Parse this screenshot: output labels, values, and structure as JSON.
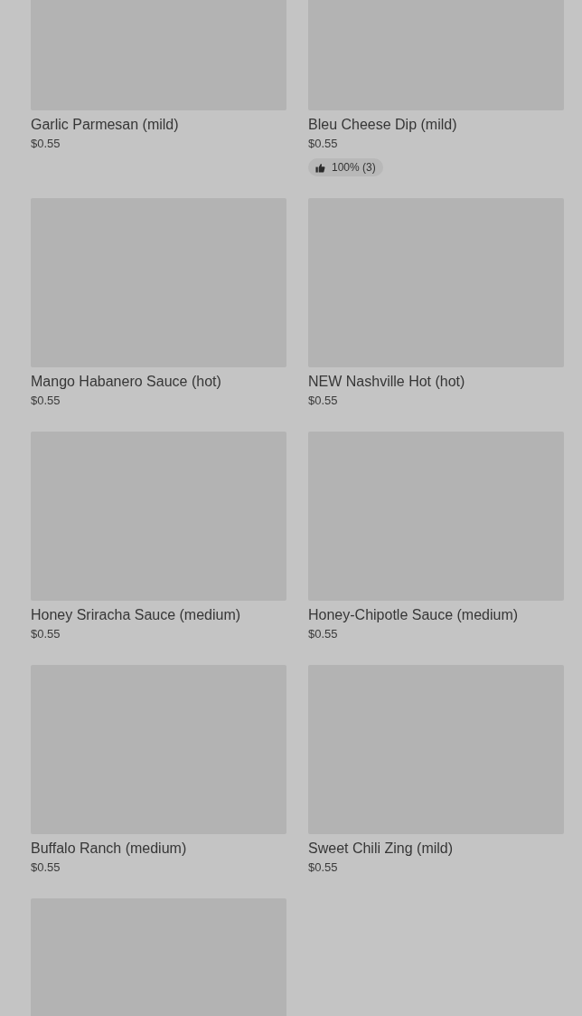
{
  "items": [
    {
      "name": "Garlic Parmesan (mild)",
      "price": "$0.55",
      "image": {
        "kind": "picture"
      }
    },
    {
      "name": "Bleu Cheese Dip (mild)",
      "price": "$0.55",
      "image": {
        "kind": "picture"
      },
      "rating": "100% (3)"
    },
    {
      "name": "Mango Habanero Sauce (hot)",
      "price": "$0.55",
      "image": {
        "kind": "picture"
      }
    },
    {
      "name": "NEW Nashville Hot (hot)",
      "price": "$0.55",
      "image": {
        "kind": "picture"
      }
    },
    {
      "name": "Honey Sriracha Sauce (medium)",
      "price": "$0.55",
      "image": {
        "kind": "picture"
      }
    },
    {
      "name": "Honey-Chipotle Sauce (medium)",
      "price": "$0.55",
      "image": {
        "kind": "picture"
      }
    },
    {
      "name": "Buffalo Ranch (medium)",
      "price": "$0.55",
      "image": {
        "kind": "picture"
      }
    },
    {
      "name": "Sweet Chili Zing (mild)",
      "price": "$0.55",
      "image": {
        "kind": "picture"
      }
    },
    {
      "image": {
        "kind": "picture"
      }
    }
  ]
}
